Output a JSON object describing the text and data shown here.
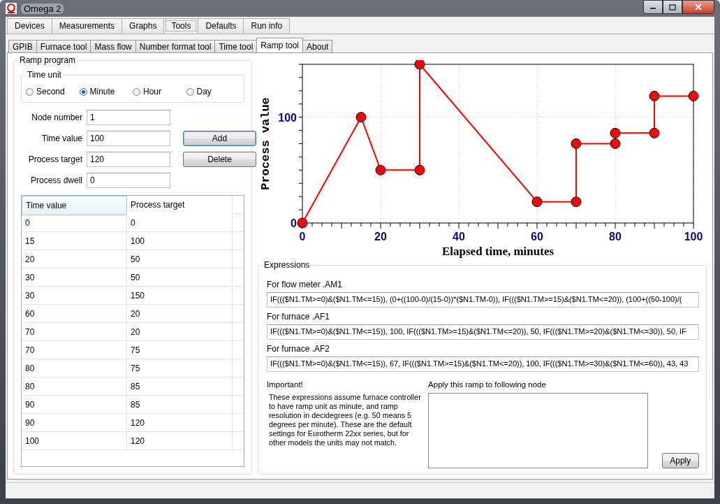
{
  "window": {
    "title": "Omega 2"
  },
  "main_tabs": [
    {
      "label": "Devices",
      "selected": false
    },
    {
      "label": "Measurements",
      "selected": false
    },
    {
      "label": "Graphs",
      "selected": false
    },
    {
      "label": "Tools",
      "selected": true
    },
    {
      "label": "Defaults",
      "selected": false
    },
    {
      "label": "Run info",
      "selected": false
    }
  ],
  "sub_tabs": [
    {
      "label": "GPIB",
      "selected": false
    },
    {
      "label": "Furnace tool",
      "selected": false
    },
    {
      "label": "Mass flow",
      "selected": false
    },
    {
      "label": "Number format tool",
      "selected": false
    },
    {
      "label": "Time tool",
      "selected": false
    },
    {
      "label": "Ramp tool",
      "selected": true
    },
    {
      "label": "About",
      "selected": false
    }
  ],
  "ramp_program": {
    "title": "Ramp program",
    "time_unit": {
      "title": "Time unit",
      "options": [
        {
          "label": "Second",
          "selected": false
        },
        {
          "label": "Minute",
          "selected": true
        },
        {
          "label": "Hour",
          "selected": false
        },
        {
          "label": "Day",
          "selected": false
        }
      ]
    },
    "fields": [
      {
        "label": "Node number",
        "value": "1"
      },
      {
        "label": "Time value",
        "value": "100"
      },
      {
        "label": "Process target",
        "value": "120"
      },
      {
        "label": "Process dwell",
        "value": "0"
      }
    ],
    "buttons": [
      "Add",
      "Delete"
    ],
    "table": {
      "columns": [
        "Time value",
        "Process target"
      ],
      "rows": [
        [
          "0",
          "0"
        ],
        [
          "15",
          "100"
        ],
        [
          "20",
          "50"
        ],
        [
          "30",
          "50"
        ],
        [
          "30",
          "150"
        ],
        [
          "60",
          "20"
        ],
        [
          "70",
          "20"
        ],
        [
          "70",
          "75"
        ],
        [
          "80",
          "75"
        ],
        [
          "80",
          "85"
        ],
        [
          "90",
          "85"
        ],
        [
          "90",
          "120"
        ],
        [
          "100",
          "120"
        ]
      ]
    }
  },
  "chart_data": {
    "type": "line",
    "xlabel": "Elapsed time, minutes",
    "ylabel": "Process value",
    "xlim": [
      0,
      100
    ],
    "ylim": [
      0,
      150
    ],
    "xticks": [
      0,
      20,
      40,
      60,
      80,
      100
    ],
    "yticks": [
      0,
      100
    ],
    "grid": true,
    "series": [
      {
        "color": "#ff0000",
        "marker": "circle",
        "x": [
          0,
          15,
          20,
          30,
          30,
          60,
          70,
          70,
          80,
          80,
          90,
          90,
          100
        ],
        "values": [
          0,
          100,
          50,
          50,
          150,
          20,
          20,
          75,
          75,
          85,
          85,
          120,
          120
        ]
      }
    ]
  },
  "expressions": {
    "title": "Expressions",
    "items": [
      {
        "label": "For flow meter .AM1",
        "value": "IF((($N1.TM>=0)&($N1.TM<=15)), (0+((100-0)/(15-0))*($N1.TM-0)), IF((($N1.TM>=15)&($N1.TM<=20)), (100+((50-100)/("
      },
      {
        "label": "For furnace .AF1",
        "value": "IF((($N1.TM>=0)&($N1.TM<=15)), 100, IF((($N1.TM>=15)&($N1.TM<=20)), 50, IF((($N1.TM>=20)&($N1.TM<=30)), 50, IF"
      },
      {
        "label": "For furnace .AF2",
        "value": "IF((($N1.TM>=0)&($N1.TM<=15)), 67, IF((($N1.TM>=15)&($N1.TM<=20)), 100, IF((($N1.TM>=30)&($N1.TM<=60)), 43, 43"
      }
    ],
    "note_title": "Important!",
    "note": "These expressions assume furnace controller to have ramp unit as minute, and ramp resolution in decidegrees (e.g. 50 means 5 degrees per minute). These are the default settings for Eurotherm 22xx series, but for other models the units may not match.",
    "apply_label": "Apply this ramp to following node",
    "apply_button": "Apply"
  }
}
